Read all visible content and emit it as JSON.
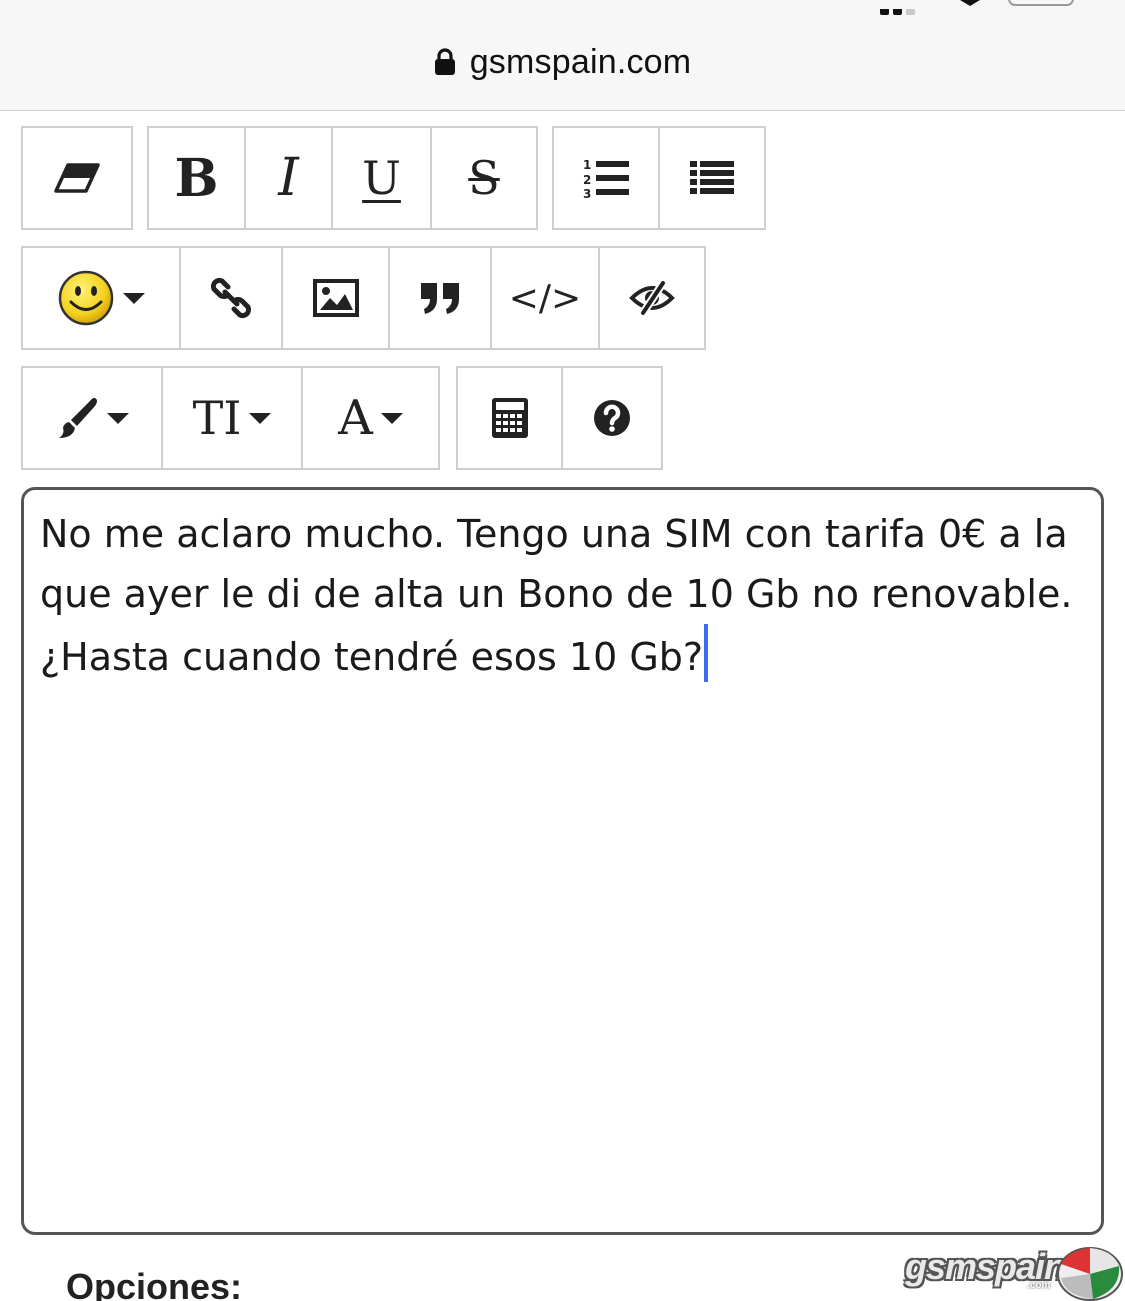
{
  "browser": {
    "url": "gsmspain.com"
  },
  "toolbar": {
    "row1": {
      "clear_format": "eraser-icon",
      "bold": "B",
      "italic": "I",
      "underline": "U",
      "strikethrough": "S",
      "ordered_list": "ordered-list-icon",
      "unordered_list": "unordered-list-icon"
    },
    "row2": {
      "emoji": "smiley-icon",
      "link": "link-icon",
      "image": "image-icon",
      "quote": "quote-icon",
      "code": "</>",
      "spoiler": "eye-slash-icon"
    },
    "row3": {
      "brush": "brush-icon",
      "font_size": "TI",
      "font_color": "A",
      "table": "calculator-icon",
      "help": "help-icon"
    }
  },
  "editor": {
    "value": "No me aclaro mucho. Tengo una SIM con tarifa 0€ a la que ayer le di de alta un Bono de 10 Gb no renovable. ¿Hasta cuando tendré esos 10 Gb?"
  },
  "options": {
    "label": "Opciones:"
  },
  "watermark": {
    "text": "gsmspain",
    "sub": ".com"
  },
  "colors": {
    "caret": "#3d6cf0",
    "border": "#cfcfcf",
    "smiley": "#f4d21f"
  }
}
